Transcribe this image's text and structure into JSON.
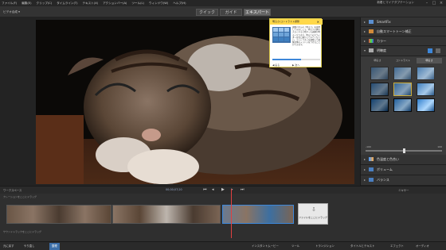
{
  "menu": {
    "items": [
      "ファイル(F)",
      "編集(E)",
      "クリップ(C)",
      "タイムライン(T)",
      "テキスト(X)",
      "アクションバー(A)",
      "ツール(L)",
      "ウィンドウ(W)",
      "ヘルプ(H)"
    ],
    "right_text": "新着とマイアダプテーション"
  },
  "toolbar": {
    "mode": "ビデオ合成 ▾",
    "tabs": [
      "クイック",
      "ガイド",
      "エキスパート"
    ]
  },
  "help": {
    "title": "明るさ/コントラスト調整",
    "close": "✕",
    "body": "調整パネルの「明るさ」を使用してみましょう。明るさの値を大きくすると暗かった画像が明るくなります。明るさのスライダーを右に動かしてみてください。コントラストを調整して画像全体のメリハリをつけることができます。",
    "prev": "◀ 戻る",
    "next": "▶ 次へ",
    "progress": 0.6
  },
  "rpanel": {
    "rows": [
      {
        "label": "SmartFix"
      },
      {
        "label": "自動スマートトーン補正"
      },
      {
        "label": "カラー"
      }
    ],
    "clarity": {
      "label": "明瞭度",
      "subtabs": [
        "明るさ",
        "コントラスト",
        "明るさ"
      ],
      "thumbs": 9,
      "selected": 4,
      "slider_lo": "-100",
      "slider_hi": "100",
      "slider_value": 0.5
    },
    "lower_rows": [
      {
        "label": "色温度と色合い"
      },
      {
        "label": "ボリューム"
      },
      {
        "label": "バランス"
      }
    ]
  },
  "timeline": {
    "header_left": "ワークスペース",
    "timecode": "00;00;07;20",
    "header_right": "ミキサー",
    "tracks": [
      "ナレーションをここにドラッグ",
      "サウンドトラックをここにドラッグ"
    ],
    "drop_label": "ファイルをここにドラッグ"
  },
  "bottombar": {
    "left": [
      "元に戻す",
      "やり直し",
      "整理"
    ],
    "right": [
      "インスタントムービー",
      "ツール",
      "トランジション",
      "タイトルとテキスト",
      "エフェクト",
      "オーディオ"
    ]
  }
}
